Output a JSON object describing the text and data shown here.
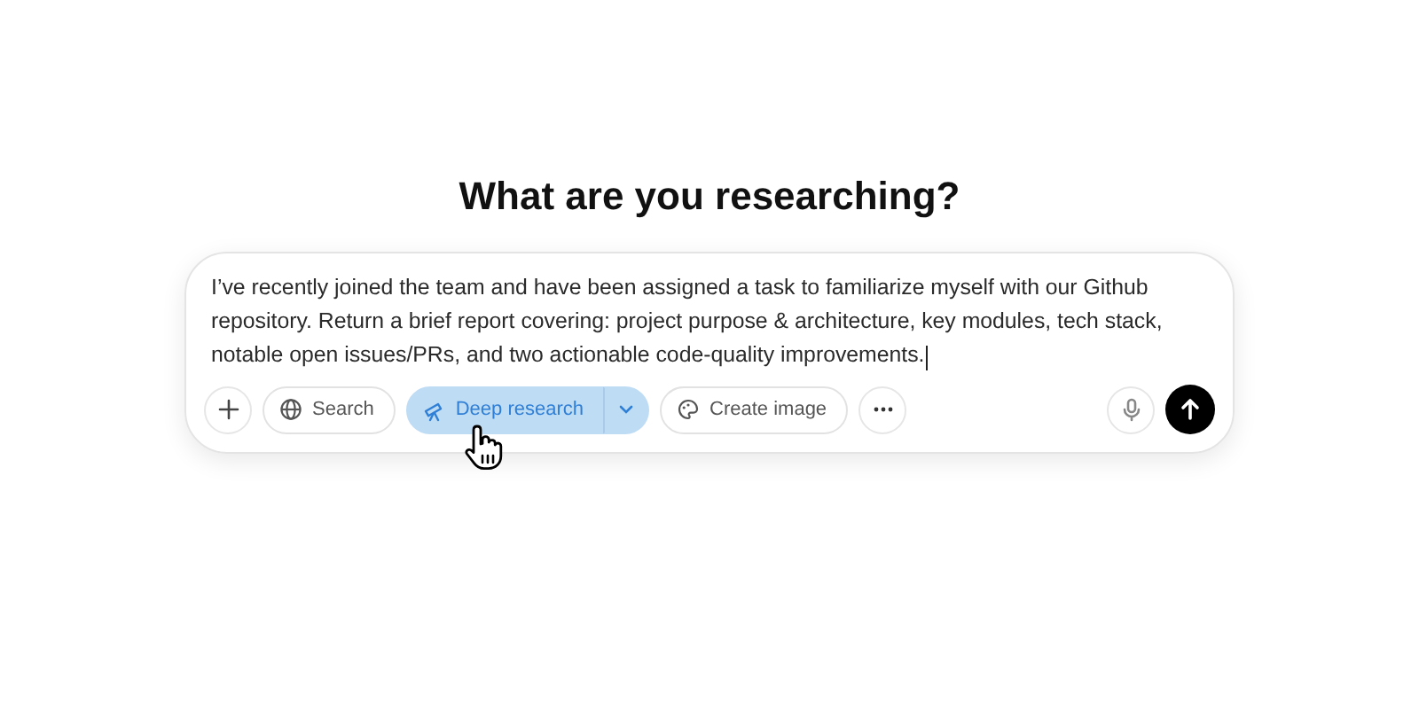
{
  "heading": "What are you researching?",
  "composer": {
    "value": "I’ve recently joined the team and have been assigned a task to familiarize myself with our Github repository. Return a brief report covering: project purpose & architecture, key modules, tech stack, notable open issues/PRs, and two actionable code-quality improvements.",
    "tools": [
      {
        "kind": "add",
        "selected": false
      },
      {
        "kind": "search",
        "label": "Search",
        "selected": false
      },
      {
        "kind": "deep-research",
        "label": "Deep research",
        "selected": true
      },
      {
        "kind": "create-image",
        "label": "Create image",
        "selected": false
      },
      {
        "kind": "more",
        "selected": false
      }
    ]
  }
}
